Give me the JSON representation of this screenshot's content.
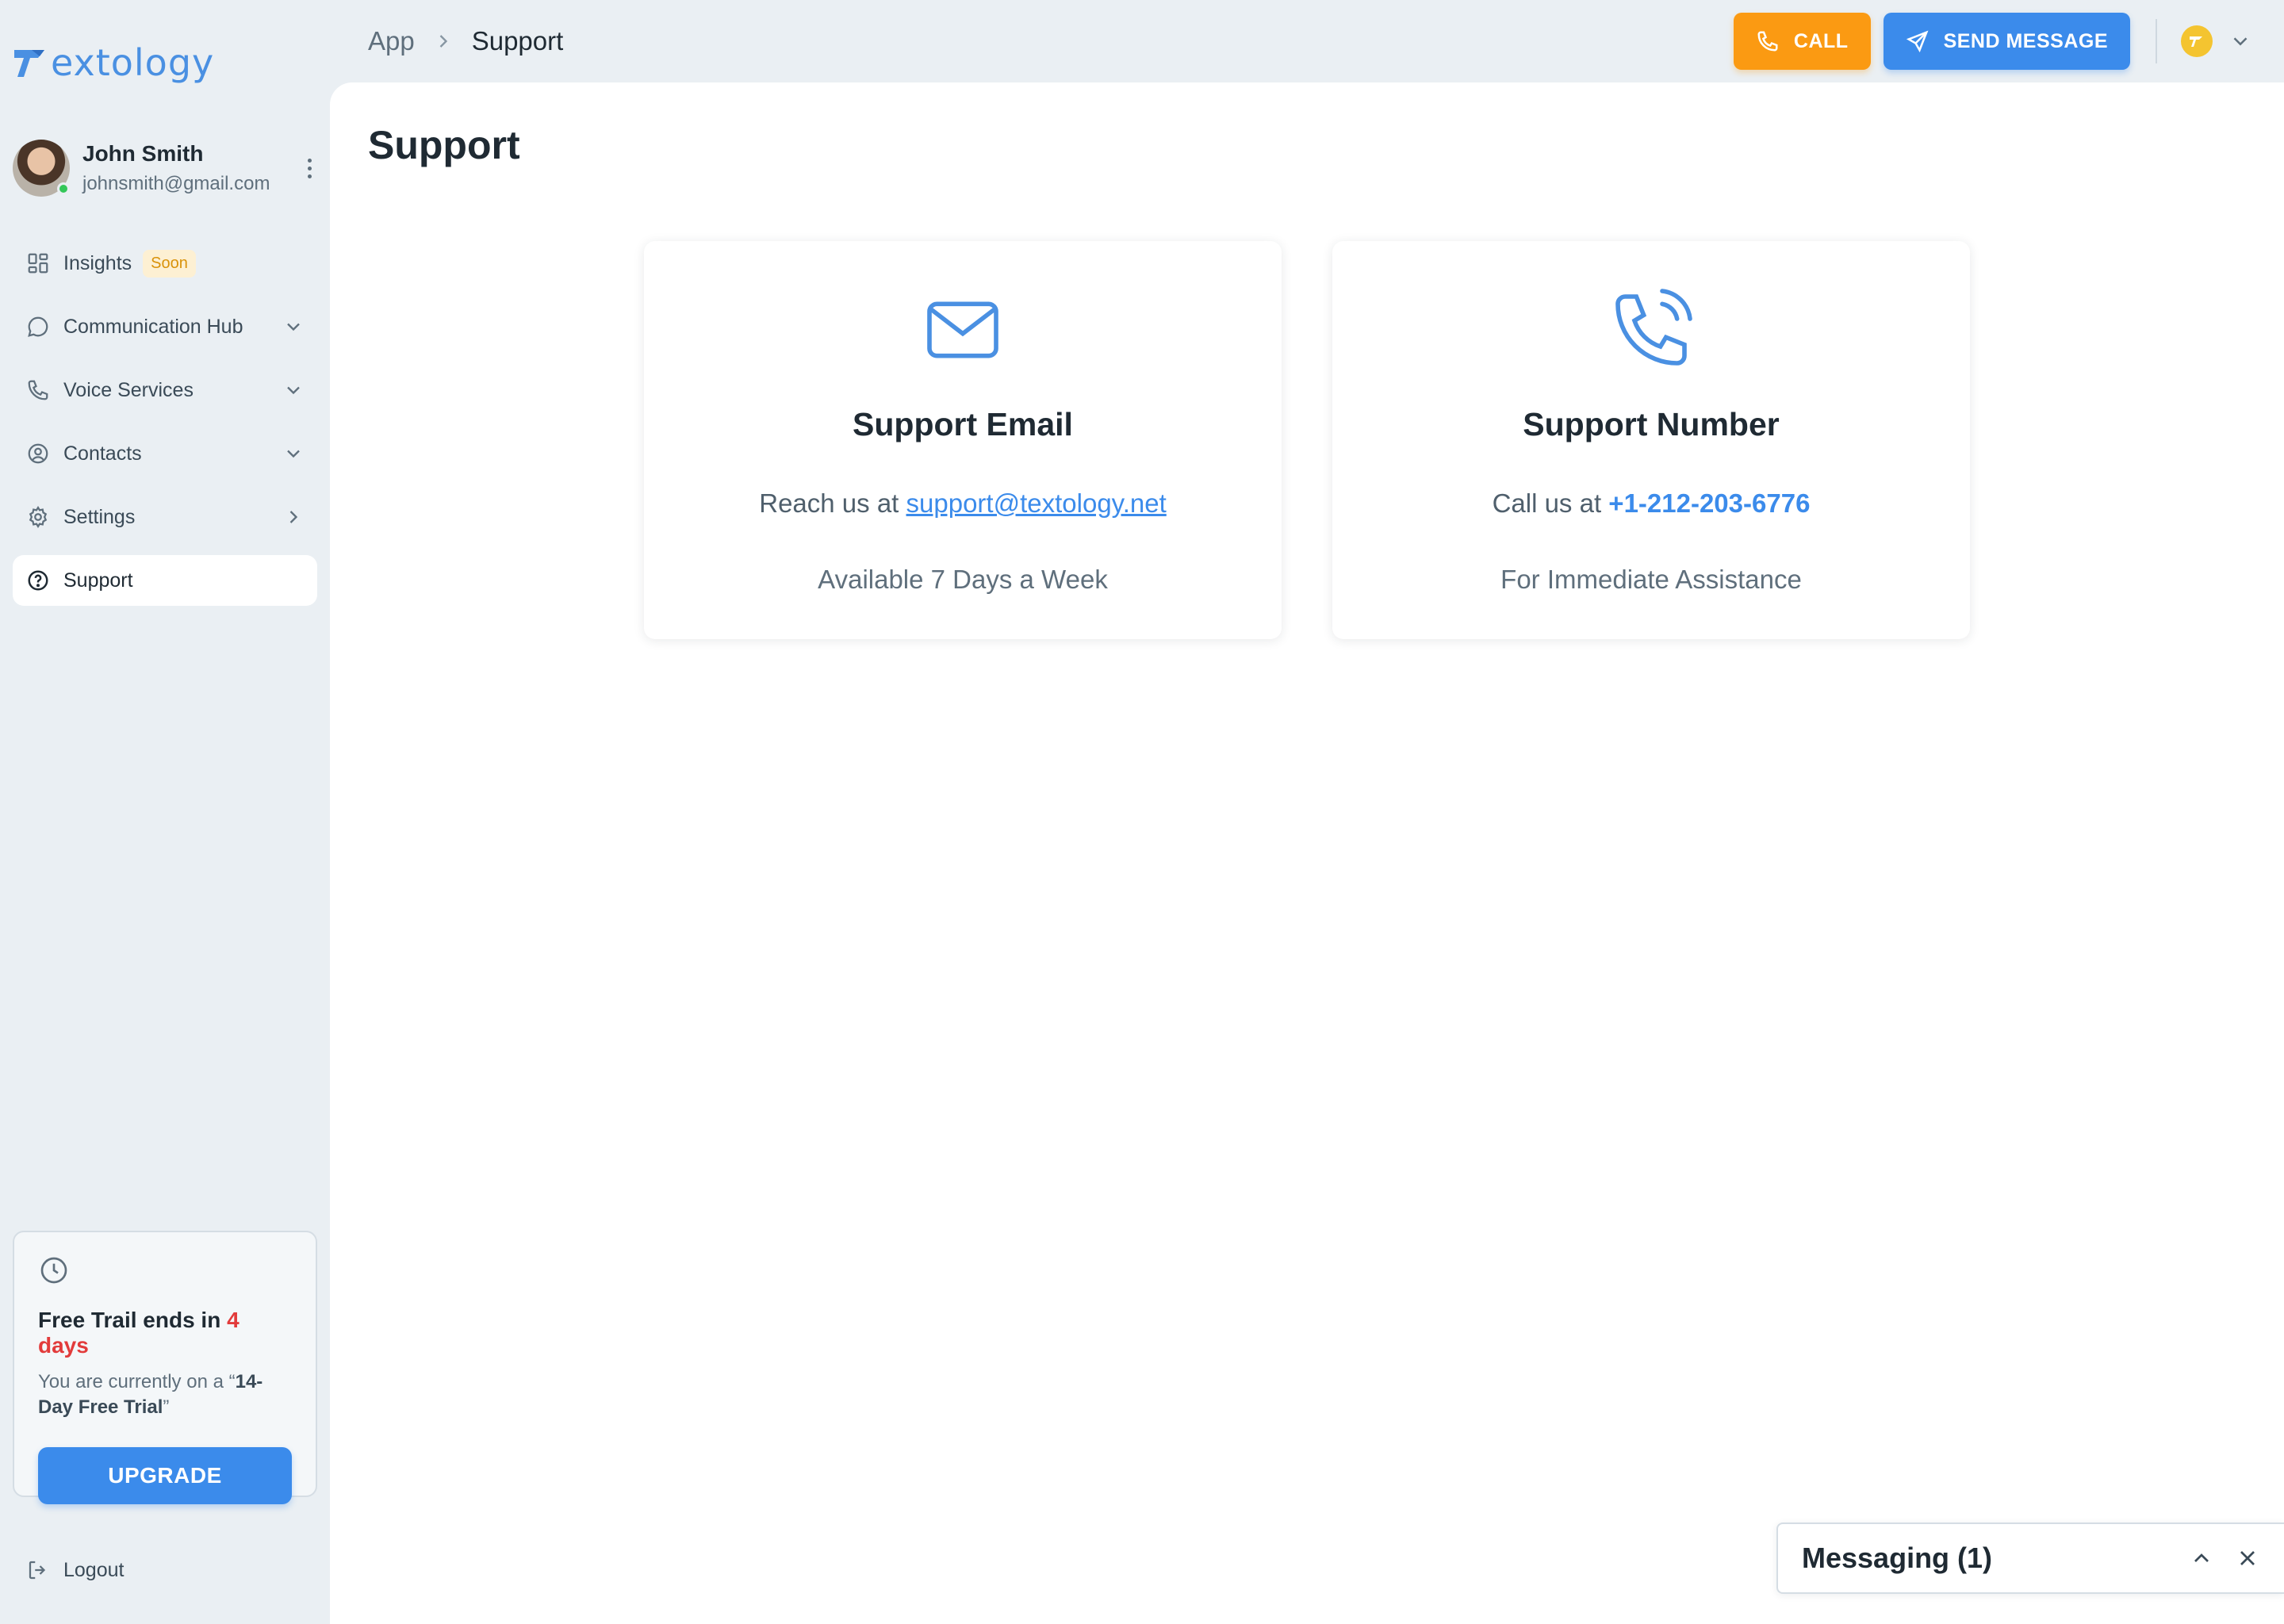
{
  "brand": {
    "name": "extology",
    "color": "#4a90e2"
  },
  "user": {
    "name": "John Smith",
    "email": "johnsmith@gmail.com",
    "status": "online"
  },
  "nav": {
    "insights": {
      "label": "Insights",
      "badge": "Soon",
      "icon": "grid-icon"
    },
    "communication_hub": {
      "label": "Communication Hub",
      "icon": "chat-bubble-icon"
    },
    "voice_services": {
      "label": "Voice Services",
      "icon": "phone-icon"
    },
    "contacts": {
      "label": "Contacts",
      "icon": "user-circle-icon"
    },
    "settings": {
      "label": "Settings",
      "icon": "gear-icon"
    },
    "support": {
      "label": "Support",
      "icon": "question-circle-icon",
      "active": true
    }
  },
  "trial": {
    "title_prefix": "Free Trail ends in ",
    "days": "4 days",
    "sub_prefix": "You are currently on a “",
    "plan": "14-Day Free Trial",
    "sub_suffix": "”",
    "upgrade_label": "UPGRADE"
  },
  "logout_label": "Logout",
  "breadcrumb": {
    "root": "App",
    "current": "Support"
  },
  "toolbar": {
    "call_label": "CALL",
    "send_label": "SEND MESSAGE",
    "call_color": "#fb9a12",
    "send_color": "#3b8beb"
  },
  "page": {
    "title": "Support"
  },
  "cards": {
    "email": {
      "title": "Support Email",
      "prefix": "Reach us at ",
      "link": "support@textology.net",
      "note": "Available 7 Days a Week",
      "icon": "envelope-icon"
    },
    "phone": {
      "title": "Support Number",
      "prefix": "Call us at ",
      "link": "+1-212-203-6776",
      "note": "For Immediate Assistance",
      "icon": "phone-ringing-icon"
    }
  },
  "messaging": {
    "title": "Messaging (1)"
  }
}
